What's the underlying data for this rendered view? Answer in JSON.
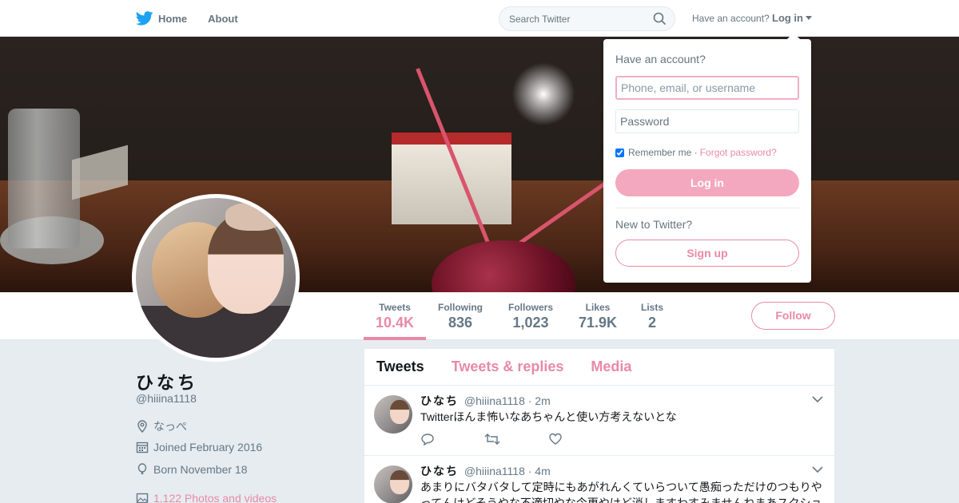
{
  "nav": {
    "home_label": "Home",
    "about_label": "About",
    "search_placeholder": "Search Twitter",
    "have_account": "Have an account?",
    "login_label": "Log in"
  },
  "profile": {
    "name": "ひなち",
    "handle": "@hiiina1118",
    "location": "なっぺ",
    "joined": "Joined February 2016",
    "born": "Born November 18",
    "media": "1,122 Photos and videos",
    "follow_label": "Follow"
  },
  "stats": [
    {
      "label": "Tweets",
      "value": "10.4K"
    },
    {
      "label": "Following",
      "value": "836"
    },
    {
      "label": "Followers",
      "value": "1,023"
    },
    {
      "label": "Likes",
      "value": "71.9K"
    },
    {
      "label": "Lists",
      "value": "2"
    }
  ],
  "timeline": {
    "tabs": [
      "Tweets",
      "Tweets & replies",
      "Media"
    ],
    "tweets": [
      {
        "name": "ひなち",
        "handle": "@hiiina1118",
        "time": "· 2m",
        "text": "Twitterほんま怖いなあちゃんと使い方考えないとな"
      },
      {
        "name": "ひなち",
        "handle": "@hiiina1118",
        "time": "· 4m",
        "text": "あまりにバタバタして定時にもあがれんくていらついて愚痴っただけのつもりやってんけどそうやな不適切やな今更やけど消しますわすみませんねまあスクショ"
      }
    ]
  },
  "login_dropdown": {
    "title": "Have an account?",
    "username_placeholder": "Phone, email, or username",
    "password_placeholder": "Password",
    "remember": "Remember me",
    "forgot": "Forgot password?",
    "login_button": "Log in",
    "new_to": "New to Twitter?",
    "signup_button": "Sign up"
  },
  "colors": {
    "accent": "#e88aa5",
    "twitter_blue": "#1da1f2",
    "text_secondary": "#657786"
  }
}
